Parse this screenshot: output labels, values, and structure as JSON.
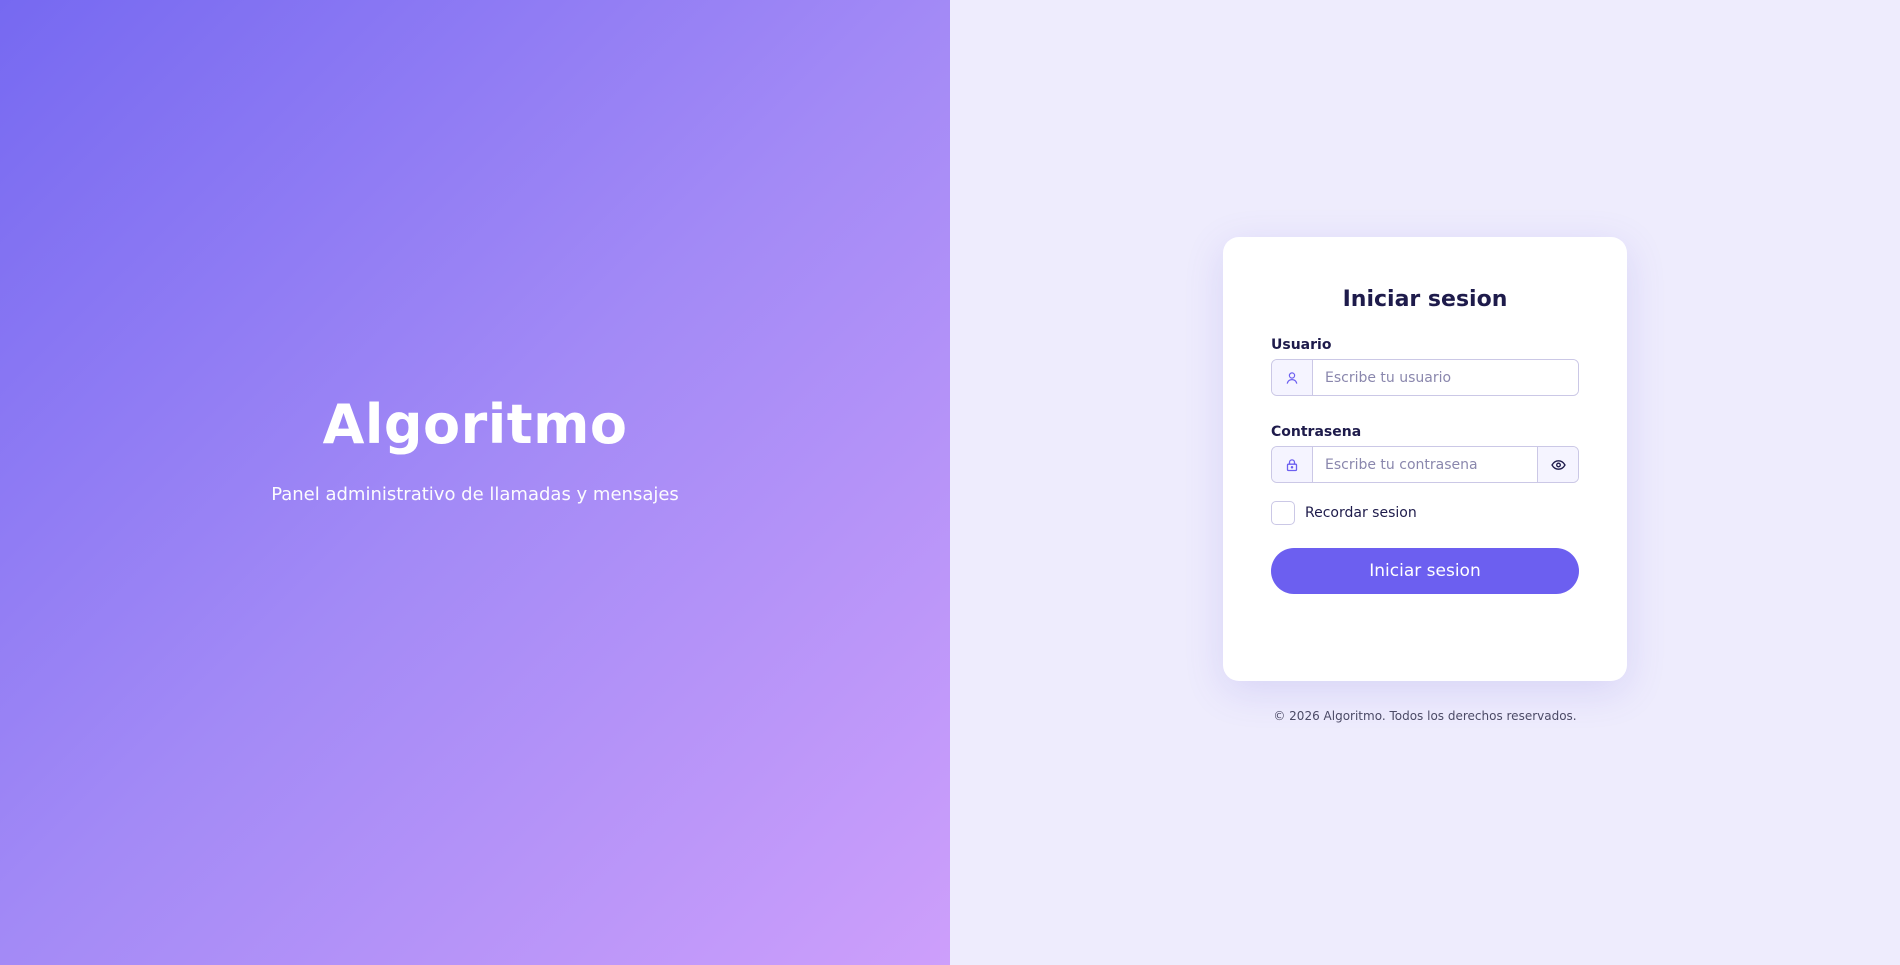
{
  "hero": {
    "title": "Algoritmo",
    "subtitle": "Panel administrativo de llamadas y mensajes"
  },
  "login": {
    "title": "Iniciar sesion",
    "username": {
      "label": "Usuario",
      "placeholder": "Escribe tu usuario",
      "value": "",
      "icon": "user-icon"
    },
    "password": {
      "label": "Contrasena",
      "placeholder": "Escribe tu contrasena",
      "value": "",
      "icon": "lock-icon",
      "toggle_icon": "eye-icon"
    },
    "remember": {
      "label": "Recordar sesion",
      "checked": false
    },
    "submit_label": "Iniciar sesion"
  },
  "footer": {
    "text": "© 2026 Algoritmo. Todos los derechos reservados."
  },
  "colors": {
    "gradient_start": "#7669f1",
    "gradient_end": "#cd9ffb",
    "accent": "#6c5ff0",
    "page_background": "#eeecfd",
    "heading_text": "#1e1b4b"
  }
}
